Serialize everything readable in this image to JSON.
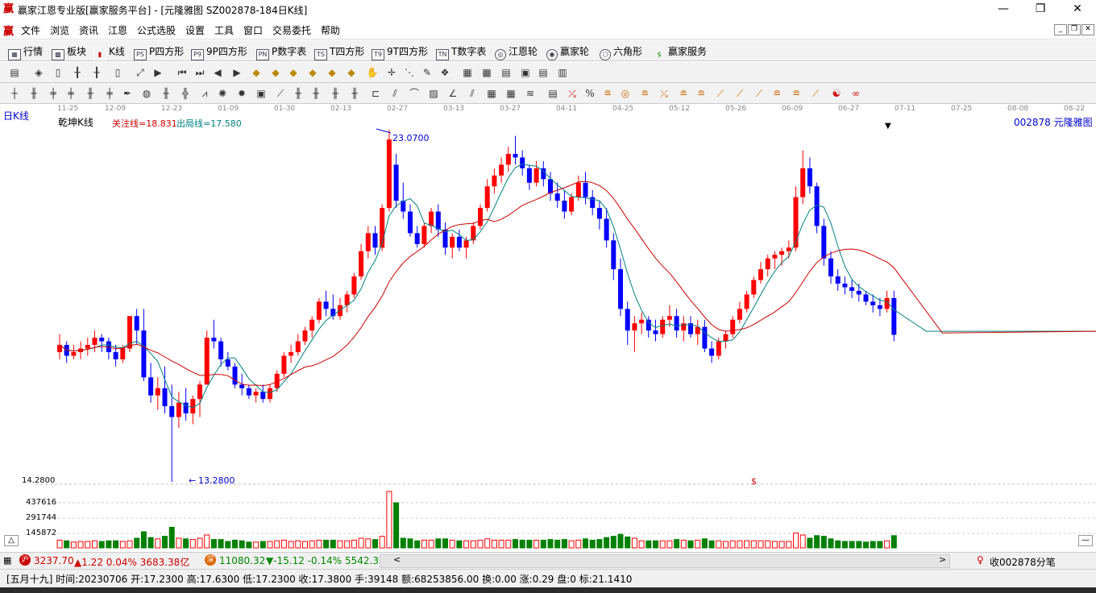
{
  "window": {
    "title": "赢家江恩专业版[赢家服务平台] - [元隆雅图  SZ002878-184日K线]",
    "logo_glyph": "赢"
  },
  "menu": [
    "文件",
    "浏览",
    "资讯",
    "江恩",
    "公式选股",
    "设置",
    "工具",
    "窗口",
    "交易委托",
    "帮助"
  ],
  "toolbar1": [
    {
      "label": "行情",
      "icon": "grid-icon"
    },
    {
      "label": "板块",
      "icon": "blocks-icon"
    },
    {
      "label": "K线",
      "icon": "candle-icon"
    },
    {
      "label": "P四方形",
      "icon": "ps-icon",
      "tag": "PS"
    },
    {
      "label": "9P四方形",
      "icon": "p9-icon",
      "tag": "P9"
    },
    {
      "label": "P数字表",
      "icon": "pn-icon",
      "tag": "PN"
    },
    {
      "label": "T四方形",
      "icon": "ts-icon",
      "tag": "TS"
    },
    {
      "label": "9T四方形",
      "icon": "t9-icon",
      "tag": "T9"
    },
    {
      "label": "T数字表",
      "icon": "tn-icon",
      "tag": "TN"
    },
    {
      "label": "江恩轮",
      "icon": "wheel-icon"
    },
    {
      "label": "赢家轮",
      "icon": "wheel2-icon"
    },
    {
      "label": "六角形",
      "icon": "hexagon-icon"
    },
    {
      "label": "赢家服务",
      "icon": "dollar-icon",
      "tag": "$"
    }
  ],
  "chart": {
    "period_label": "日K线",
    "indicator_name": "乾坤K线",
    "watch_line": "关注线=18.831",
    "exit_line": "出局线=17.580",
    "symbol_label": "002878  元隆雅图",
    "high_label": "23.0700",
    "low_label": "13.2800",
    "price_axis_label": "14.2800",
    "volume_labels": [
      "437616",
      "291744",
      "145872"
    ],
    "dollar_marker": "$",
    "dates": [
      "11-25",
      "12-09",
      "12-23",
      "01-09",
      "01-30",
      "02-13",
      "02-27",
      "03-13",
      "03-27",
      "04-11",
      "04-25",
      "05-12",
      "05-26",
      "06-09",
      "06-27",
      "07-11",
      "07-25",
      "08-08",
      "08-22"
    ]
  },
  "chart_data": {
    "type": "candlestick",
    "price_range": [
      13.28,
      23.07
    ],
    "last_close": 17.38,
    "candles_ohlc": [
      [
        16.9,
        17.4,
        16.7,
        17.1
      ],
      [
        17.1,
        17.2,
        16.6,
        16.8
      ],
      [
        16.8,
        17.1,
        16.7,
        16.9
      ],
      [
        16.9,
        17.2,
        16.7,
        17.0
      ],
      [
        17.0,
        17.3,
        16.8,
        17.1
      ],
      [
        17.1,
        17.5,
        16.9,
        17.3
      ],
      [
        17.3,
        17.4,
        16.9,
        17.2
      ],
      [
        17.2,
        17.3,
        16.7,
        16.9
      ],
      [
        16.9,
        17.1,
        16.5,
        16.7
      ],
      [
        16.7,
        17.1,
        16.6,
        17.0
      ],
      [
        17.0,
        17.5,
        16.9,
        17.9
      ],
      [
        17.9,
        18.1,
        17.1,
        17.5
      ],
      [
        17.5,
        18.1,
        16.1,
        16.2
      ],
      [
        16.2,
        16.6,
        15.5,
        15.7
      ],
      [
        15.7,
        16.2,
        15.3,
        15.9
      ],
      [
        15.9,
        16.5,
        15.2,
        15.4
      ],
      [
        15.4,
        16.0,
        13.3,
        15.1
      ],
      [
        15.1,
        15.8,
        14.8,
        15.5
      ],
      [
        15.5,
        15.9,
        15.0,
        15.2
      ],
      [
        15.2,
        15.7,
        14.9,
        15.6
      ],
      [
        15.6,
        16.1,
        15.1,
        16.0
      ],
      [
        16.0,
        17.5,
        16.0,
        17.3
      ],
      [
        17.3,
        17.8,
        17.0,
        17.2
      ],
      [
        17.2,
        17.3,
        16.5,
        16.7
      ],
      [
        16.7,
        16.9,
        16.4,
        16.5
      ],
      [
        16.5,
        16.6,
        15.9,
        16.0
      ],
      [
        16.0,
        16.3,
        15.7,
        15.9
      ],
      [
        15.9,
        16.0,
        15.6,
        15.7
      ],
      [
        15.7,
        15.9,
        15.5,
        15.8
      ],
      [
        15.8,
        16.0,
        15.5,
        15.6
      ],
      [
        15.6,
        16.0,
        15.5,
        15.9
      ],
      [
        15.9,
        16.4,
        15.8,
        16.3
      ],
      [
        16.3,
        16.9,
        16.2,
        16.8
      ],
      [
        16.8,
        17.1,
        16.6,
        16.9
      ],
      [
        16.9,
        17.4,
        16.8,
        17.2
      ],
      [
        17.2,
        17.6,
        17.1,
        17.5
      ],
      [
        17.5,
        17.9,
        17.3,
        17.8
      ],
      [
        17.8,
        18.4,
        17.7,
        18.3
      ],
      [
        18.3,
        18.6,
        17.9,
        18.1
      ],
      [
        18.1,
        18.5,
        17.8,
        17.9
      ],
      [
        17.9,
        18.4,
        17.8,
        18.2
      ],
      [
        18.2,
        18.6,
        18.0,
        18.5
      ],
      [
        18.5,
        19.1,
        18.4,
        19.0
      ],
      [
        19.0,
        19.9,
        18.9,
        19.7
      ],
      [
        19.7,
        20.4,
        19.5,
        20.2
      ],
      [
        20.2,
        20.4,
        19.6,
        19.8
      ],
      [
        19.8,
        21.0,
        19.7,
        20.9
      ],
      [
        20.9,
        23.07,
        20.8,
        22.8
      ],
      [
        22.1,
        22.4,
        20.9,
        21.1
      ],
      [
        21.1,
        21.6,
        20.6,
        20.8
      ],
      [
        20.8,
        21.0,
        20.1,
        20.2
      ],
      [
        20.2,
        20.4,
        19.8,
        19.9
      ],
      [
        19.9,
        20.5,
        19.8,
        20.4
      ],
      [
        20.4,
        20.9,
        20.2,
        20.8
      ],
      [
        20.8,
        21.0,
        20.1,
        20.3
      ],
      [
        20.3,
        20.5,
        19.6,
        19.8
      ],
      [
        19.8,
        20.2,
        19.5,
        20.1
      ],
      [
        20.1,
        20.3,
        19.7,
        19.8
      ],
      [
        19.8,
        20.1,
        19.5,
        20.0
      ],
      [
        20.0,
        20.5,
        19.9,
        20.4
      ],
      [
        20.4,
        21.0,
        20.3,
        20.9
      ],
      [
        20.9,
        21.7,
        20.8,
        21.5
      ],
      [
        21.5,
        22.0,
        21.3,
        21.8
      ],
      [
        21.8,
        22.3,
        21.6,
        22.1
      ],
      [
        22.1,
        22.6,
        21.9,
        22.4
      ],
      [
        22.4,
        22.9,
        22.1,
        22.3
      ],
      [
        22.3,
        22.5,
        21.8,
        22.0
      ],
      [
        22.0,
        22.1,
        21.4,
        21.6
      ],
      [
        21.6,
        22.2,
        21.5,
        22.0
      ],
      [
        22.0,
        22.2,
        21.5,
        21.7
      ],
      [
        21.7,
        21.9,
        21.1,
        21.3
      ],
      [
        21.3,
        21.6,
        20.9,
        21.1
      ],
      [
        21.1,
        21.4,
        20.6,
        20.8
      ],
      [
        20.8,
        21.3,
        20.7,
        21.2
      ],
      [
        21.2,
        21.8,
        21.1,
        21.6
      ],
      [
        21.6,
        21.9,
        21.0,
        21.2
      ],
      [
        21.2,
        21.4,
        20.7,
        20.9
      ],
      [
        20.9,
        21.1,
        20.3,
        20.6
      ],
      [
        20.6,
        20.9,
        19.8,
        20.0
      ],
      [
        20.0,
        20.2,
        18.9,
        19.2
      ],
      [
        19.2,
        19.5,
        17.9,
        18.1
      ],
      [
        18.1,
        18.3,
        17.1,
        17.5
      ],
      [
        17.5,
        17.9,
        16.9,
        17.7
      ],
      [
        17.7,
        18.0,
        17.4,
        17.8
      ],
      [
        17.8,
        17.9,
        17.3,
        17.5
      ],
      [
        17.5,
        17.8,
        17.2,
        17.4
      ],
      [
        17.4,
        17.9,
        17.3,
        17.8
      ],
      [
        17.8,
        18.2,
        17.6,
        17.9
      ],
      [
        17.9,
        18.1,
        17.3,
        17.5
      ],
      [
        17.5,
        17.9,
        17.2,
        17.7
      ],
      [
        17.7,
        17.9,
        17.3,
        17.4
      ],
      [
        17.4,
        17.8,
        17.1,
        17.6
      ],
      [
        17.6,
        17.8,
        16.9,
        17.0
      ],
      [
        17.0,
        17.2,
        16.6,
        16.8
      ],
      [
        16.8,
        17.3,
        16.7,
        17.2
      ],
      [
        17.2,
        17.5,
        17.0,
        17.4
      ],
      [
        17.4,
        17.9,
        17.3,
        17.8
      ],
      [
        17.8,
        18.3,
        17.7,
        18.1
      ],
      [
        18.1,
        18.6,
        18.0,
        18.5
      ],
      [
        18.5,
        19.0,
        18.4,
        18.9
      ],
      [
        18.9,
        19.4,
        18.8,
        19.2
      ],
      [
        19.2,
        19.6,
        19.0,
        19.5
      ],
      [
        19.5,
        19.7,
        19.2,
        19.6
      ],
      [
        19.6,
        19.8,
        19.3,
        19.7
      ],
      [
        19.7,
        20.0,
        19.5,
        19.8
      ],
      [
        19.8,
        21.5,
        19.7,
        21.2
      ],
      [
        21.2,
        22.5,
        21.0,
        22.0
      ],
      [
        22.0,
        22.3,
        21.3,
        21.5
      ],
      [
        21.5,
        21.6,
        20.2,
        20.4
      ],
      [
        20.4,
        20.6,
        19.3,
        19.5
      ],
      [
        19.5,
        19.7,
        18.8,
        19.0
      ],
      [
        19.0,
        19.2,
        18.6,
        18.8
      ],
      [
        18.8,
        19.0,
        18.5,
        18.7
      ],
      [
        18.7,
        18.9,
        18.4,
        18.6
      ],
      [
        18.6,
        18.8,
        18.3,
        18.5
      ],
      [
        18.5,
        18.6,
        18.2,
        18.3
      ],
      [
        18.3,
        18.5,
        18.0,
        18.2
      ],
      [
        18.2,
        18.4,
        17.9,
        18.1
      ],
      [
        18.1,
        18.6,
        18.0,
        18.4
      ],
      [
        18.4,
        18.6,
        17.2,
        17.38
      ]
    ]
  },
  "statusbar": {
    "index1": "3237.70",
    "index1_change": "▲1.22 0.04% 3683.38亿",
    "index2": "11080.32",
    "index2_change": "▼-15.12 -0.14% 5542.38",
    "right_text": "收002878分笔"
  },
  "infobar": {
    "text": "[五月十九] 时间:20230706 开:17.2300 高:17.6300 低:17.2300 收:17.3800 手:39148 额:68253856.00 换:0.00 涨:0.29 盘:0 标:21.1410"
  },
  "colors": {
    "up": "#ff0000",
    "down": "#0000ff",
    "neutral": "#7f1f8f",
    "volume_up": "#ff0000",
    "volume_down": "#008000",
    "ma_short": "#008080",
    "ma_long": "#cc0000"
  }
}
